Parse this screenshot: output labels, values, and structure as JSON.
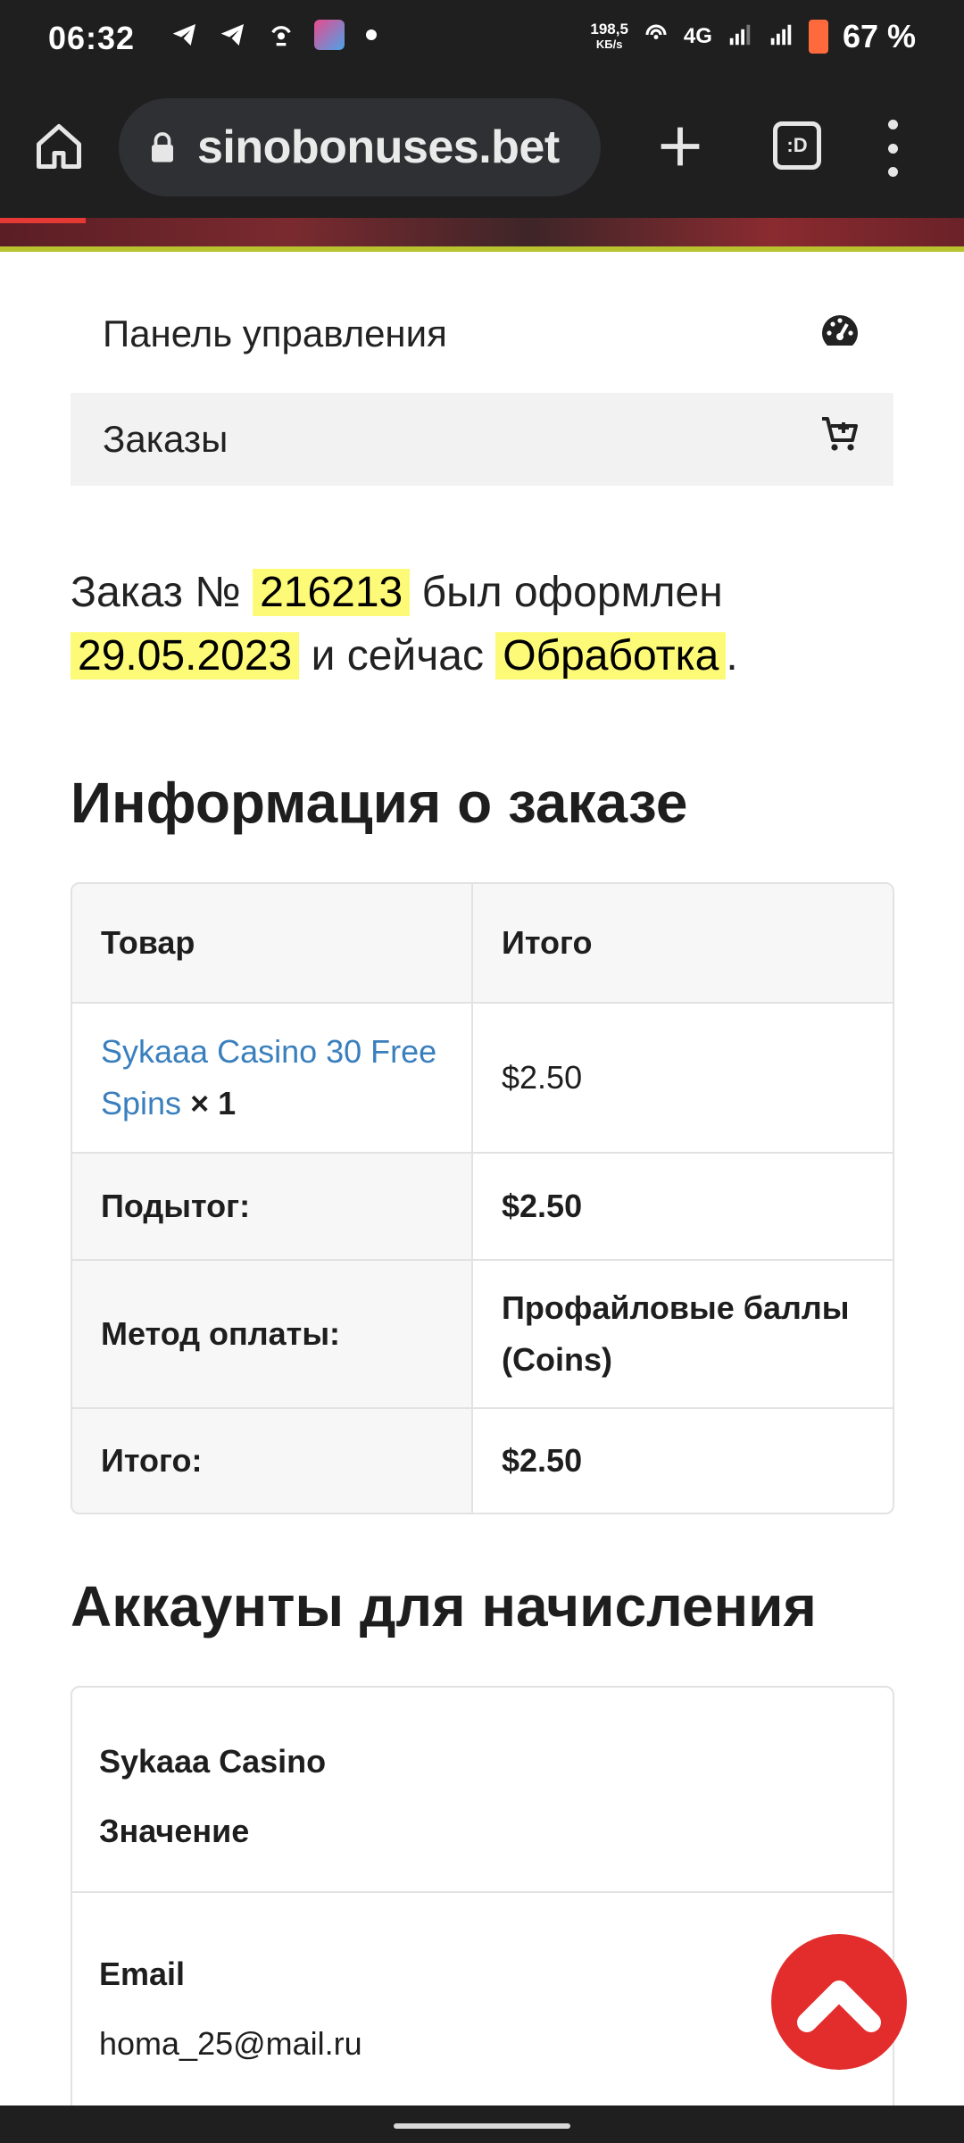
{
  "status_bar": {
    "time": "06:32",
    "speed_value": "198,5",
    "speed_unit": "KБ/s",
    "network": "4G",
    "battery": "67 %"
  },
  "browser": {
    "url": "sinobonuses.bet",
    "tabs_label": ":D"
  },
  "nav": {
    "dashboard": "Панель управления",
    "orders": "Заказы"
  },
  "order_notice": {
    "prefix": "Заказ №",
    "number": "216213",
    "middle": "был оформлен",
    "date": "29.05.2023",
    "and_now": "и сейчас",
    "status": "Обработка",
    "end": "."
  },
  "order_info": {
    "title": "Информация о заказе",
    "head_product": "Товар",
    "head_total": "Итого",
    "item_name": "Sykaaa Casino 30 Free Spins",
    "item_qty": "× 1",
    "item_price": "$2.50",
    "subtotal_label": "Подытог:",
    "subtotal_value": "$2.50",
    "payment_label": "Метод оплаты:",
    "payment_value": "Профайловые баллы (Coins)",
    "total_label": "Итого:",
    "total_value": "$2.50"
  },
  "accounts": {
    "title": "Аккаунты для начисления",
    "casino": "Sykaaa Casino",
    "value_label": "Значение",
    "email_label": "Email",
    "email_value": "homa_25@mail.ru"
  }
}
